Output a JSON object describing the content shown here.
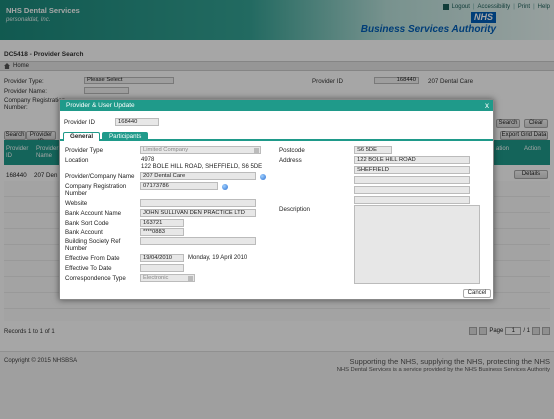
{
  "header": {
    "brand": "NHS Dental Services",
    "tagline": "personaldat, Inc.",
    "nhs": "NHS",
    "bsa": "Business Services Authority",
    "links": [
      "Logout",
      "Accessibility",
      "Print",
      "Help"
    ]
  },
  "page": {
    "title": "DC5418 - Provider Search",
    "home": "Home"
  },
  "search": {
    "provider_type_label": "Provider Type:",
    "provider_type_value": "Please Select",
    "provider_name_label": "Provider Name:",
    "company_reg_label": "Company Registration Number:",
    "provider_id_label": "Provider ID",
    "provider_id_value": "168440",
    "provider_id_name": "207 Dental Care",
    "search_btn": "Search",
    "clear_btn": "Clear",
    "export_btn": "Export Grid Data",
    "search_tab": "Search",
    "provider_id_tab": "Provider ID"
  },
  "grid": {
    "columns": [
      "Provider ID",
      "Provider Name",
      "ation",
      "Action"
    ],
    "row": {
      "id": "168440",
      "name": "207 Den",
      "action": "Details"
    },
    "records": "Records 1 to 1 of 1",
    "page_label": "Page",
    "page_value": "1",
    "page_of": "/ 1"
  },
  "footer": {
    "copyright": "Copyright © 2015 NHSBSA",
    "tagline": "Supporting the NHS, supplying the NHS, protecting the NHS",
    "sub": "NHS Dental Services is a service provided by the NHS Business Services Authority"
  },
  "modal": {
    "title": "Provider & User Update",
    "close": "x",
    "provider_id_label": "Provider ID",
    "provider_id_value": "168440",
    "tabs": [
      "General",
      "Participants"
    ],
    "left": {
      "provider_type_label": "Provider Type",
      "provider_type_value": "Limited Company",
      "location_label": "Location",
      "location_code": "4978",
      "location_address": "122 BOLE HILL ROAD, SHEFFIELD, S6 5DE",
      "company_name_label": "Provider/Company Name",
      "company_name_value": "207 Dental Care",
      "company_reg_label": "Company Registration Number",
      "company_reg_value": "07173786",
      "website_label": "Website",
      "website_value": "",
      "bank_name_label": "Bank Account Name",
      "bank_name_value": "JOHN SULLIVAN DEN PRACTICE LTD",
      "sort_code_label": "Bank Sort Code",
      "sort_code_value": "163721",
      "account_label": "Bank Account",
      "account_value": "****0883",
      "bsoc_ref_label": "Building Society Ref Number",
      "bsoc_ref_value": "",
      "eff_from_label": "Effective From Date",
      "eff_from_value": "19/04/2010",
      "eff_from_text": "Monday, 19 April 2010",
      "eff_to_label": "Effective To Date",
      "eff_to_value": "",
      "corr_type_label": "Correspondence Type",
      "corr_type_value": "Electronic"
    },
    "right": {
      "postcode_label": "Postcode",
      "postcode_value": "S6 5DE",
      "address_label": "Address",
      "address_lines": [
        "122 BOLE HILL ROAD",
        "SHEFFIELD",
        "",
        "",
        ""
      ],
      "description_label": "Description"
    },
    "cancel": "Cancel"
  }
}
